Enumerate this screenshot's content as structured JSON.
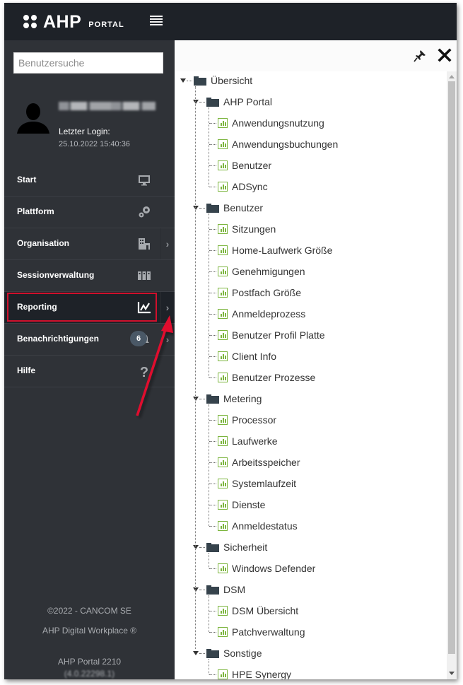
{
  "app": {
    "brand": "AHP",
    "brand_suffix": "PORTAL"
  },
  "sidebar": {
    "search_placeholder": "Benutzersuche",
    "profile": {
      "last_login_label": "Letzter Login:",
      "last_login_time": "25.10.2022 15:40:36"
    },
    "items": [
      {
        "label": "Start",
        "icon": "monitor-icon",
        "has_submenu": false
      },
      {
        "label": "Plattform",
        "icon": "gears-icon",
        "has_submenu": false
      },
      {
        "label": "Organisation",
        "icon": "building-icon",
        "has_submenu": true
      },
      {
        "label": "Sessionverwaltung",
        "icon": "sessions-icon",
        "has_submenu": false
      },
      {
        "label": "Reporting",
        "icon": "line-chart-icon",
        "has_submenu": true,
        "active": true
      },
      {
        "label": "Benachrichtigungen",
        "icon": "bell-icon",
        "has_submenu": true,
        "badge": "6"
      },
      {
        "label": "Hilfe",
        "icon": "question-icon",
        "has_submenu": false
      }
    ],
    "footer": {
      "copyright": "©2022 - CANCOM SE",
      "product": "AHP Digital Workplace ®",
      "version": "AHP Portal 2210",
      "build": "(4.0.22298.1)"
    }
  },
  "panel": {
    "tree": {
      "root": "Übersicht",
      "groups": [
        {
          "label": "AHP Portal",
          "items": [
            "Anwendungsnutzung",
            "Anwendungsbuchungen",
            "Benutzer",
            "ADSync"
          ]
        },
        {
          "label": "Benutzer",
          "items": [
            "Sitzungen",
            "Home-Laufwerk Größe",
            "Genehmigungen",
            "Postfach Größe",
            "Anmeldeprozess",
            "Benutzer Profil Platte",
            "Client Info",
            "Benutzer Prozesse"
          ]
        },
        {
          "label": "Metering",
          "items": [
            "Processor",
            "Laufwerke",
            "Arbeitsspeicher",
            "Systemlaufzeit",
            "Dienste",
            "Anmeldestatus"
          ]
        },
        {
          "label": "Sicherheit",
          "items": [
            "Windows Defender"
          ]
        },
        {
          "label": "DSM",
          "items": [
            "DSM Übersicht",
            "Patchverwaltung"
          ]
        },
        {
          "label": "Sonstige",
          "items": [
            "HPE Synergy"
          ]
        }
      ]
    }
  },
  "colors": {
    "topbar": "#1e2228",
    "sidebar": "#2f3237",
    "highlight": "#d0102c",
    "report_icon": "#7cb53e",
    "folder_icon": "#36434c",
    "badge": "#4a5866"
  }
}
